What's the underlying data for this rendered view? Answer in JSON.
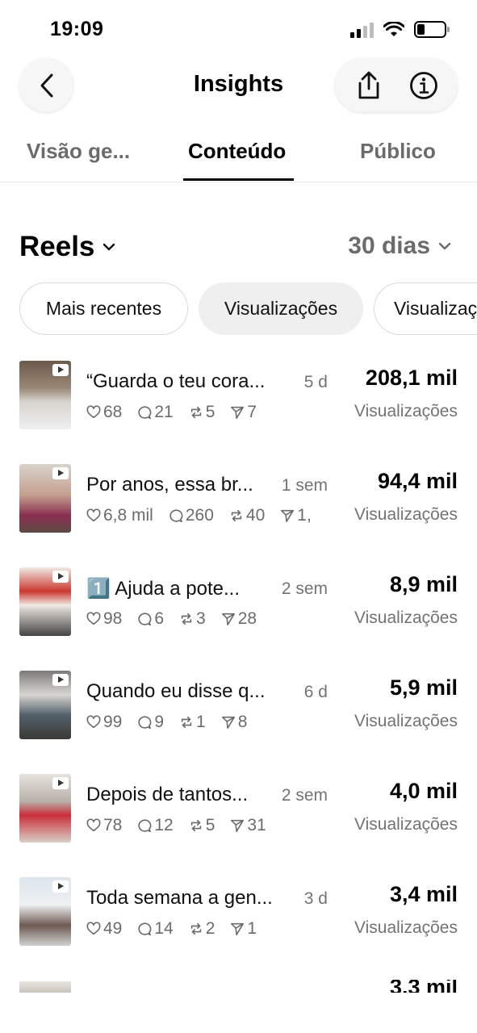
{
  "status_bar": {
    "time": "19:09"
  },
  "header": {
    "title": "Insights"
  },
  "tabs": [
    {
      "label": "Visão ge..."
    },
    {
      "label": "Conteúdo"
    },
    {
      "label": "Público"
    }
  ],
  "section": {
    "title": "Reels",
    "period": "30 dias"
  },
  "filters": [
    {
      "label": "Mais recentes"
    },
    {
      "label": "Visualizações"
    },
    {
      "label": "Visualizaç"
    }
  ],
  "reels": [
    {
      "caption": "“Guarda o teu cora...",
      "age": "5 d",
      "likes": "68",
      "comments": "21",
      "reposts": "5",
      "shares": "7",
      "value": "208,1 mil",
      "metric": "Visualizações"
    },
    {
      "caption": "Por anos, essa br...",
      "age": "1 sem",
      "likes": "6,8 mil",
      "comments": "260",
      "reposts": "40",
      "shares": "1,",
      "value": "94,4 mil",
      "metric": "Visualizações"
    },
    {
      "caption": "1️⃣ Ajuda a pote...",
      "age": "2 sem",
      "likes": "98",
      "comments": "6",
      "reposts": "3",
      "shares": "28",
      "value": "8,9 mil",
      "metric": "Visualizações"
    },
    {
      "caption": "Quando eu disse q...",
      "age": "6 d",
      "likes": "99",
      "comments": "9",
      "reposts": "1",
      "shares": "8",
      "value": "5,9 mil",
      "metric": "Visualizações"
    },
    {
      "caption": "Depois de tantos...",
      "age": "2 sem",
      "likes": "78",
      "comments": "12",
      "reposts": "5",
      "shares": "31",
      "value": "4,0 mil",
      "metric": "Visualizações"
    },
    {
      "caption": "Toda semana a gen...",
      "age": "3 d",
      "likes": "49",
      "comments": "14",
      "reposts": "2",
      "shares": "1",
      "value": "3,4 mil",
      "metric": "Visualizações"
    }
  ],
  "partial_reel": {
    "value": "3,3 mil"
  },
  "colors": {
    "secondary_text": "#737373",
    "chip_selected_bg": "#efeff0",
    "divider": "#e6e6e6"
  }
}
